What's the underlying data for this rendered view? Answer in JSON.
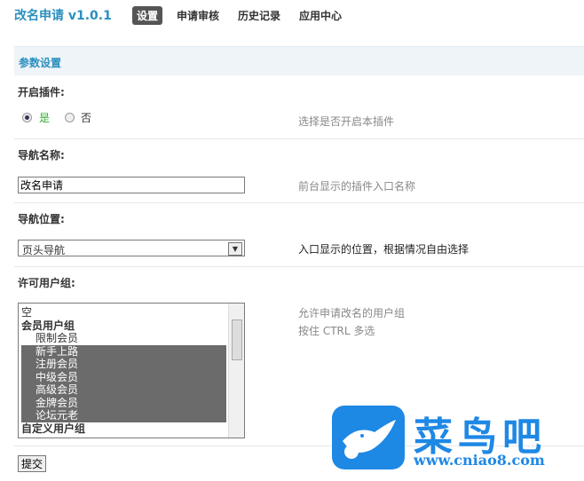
{
  "header": {
    "title": "改名申请 v1.0.1",
    "tabs": [
      {
        "label": "设置",
        "active": true
      },
      {
        "label": "申请审核"
      },
      {
        "label": "历史记录"
      },
      {
        "label": "应用中心"
      }
    ]
  },
  "section": {
    "title": "参数设置"
  },
  "enable": {
    "label": "开启插件:",
    "yes": "是",
    "no": "否",
    "selected": "是",
    "desc": "选择是否开启本插件"
  },
  "nav_name": {
    "label": "导航名称:",
    "value": "改名申请",
    "desc": "前台显示的插件入口名称"
  },
  "nav_pos": {
    "label": "导航位置:",
    "value": "页头导航",
    "desc": "入口显示的位置，根据情况自由选择"
  },
  "groups": {
    "label": "许可用户组:",
    "desc1": "允许申请改名的用户组",
    "desc2": "按住 CTRL 多选",
    "options": [
      {
        "text": "空",
        "type": "opt"
      },
      {
        "text": "会员用户组",
        "type": "grp"
      },
      {
        "text": "限制会员",
        "type": "sub"
      },
      {
        "text": "新手上路",
        "type": "sub",
        "selected": true
      },
      {
        "text": "注册会员",
        "type": "sub",
        "selected": true
      },
      {
        "text": "中级会员",
        "type": "sub",
        "selected": true
      },
      {
        "text": "高级会员",
        "type": "sub",
        "selected": true
      },
      {
        "text": "金牌会员",
        "type": "sub",
        "selected": true
      },
      {
        "text": "论坛元老",
        "type": "sub",
        "selected": true
      },
      {
        "text": "自定义用户组",
        "type": "grp"
      }
    ]
  },
  "submit_label": "提交",
  "watermark": {
    "name": "菜鸟吧",
    "url": "www.cniao8.com",
    "color": "#1e88e5"
  }
}
